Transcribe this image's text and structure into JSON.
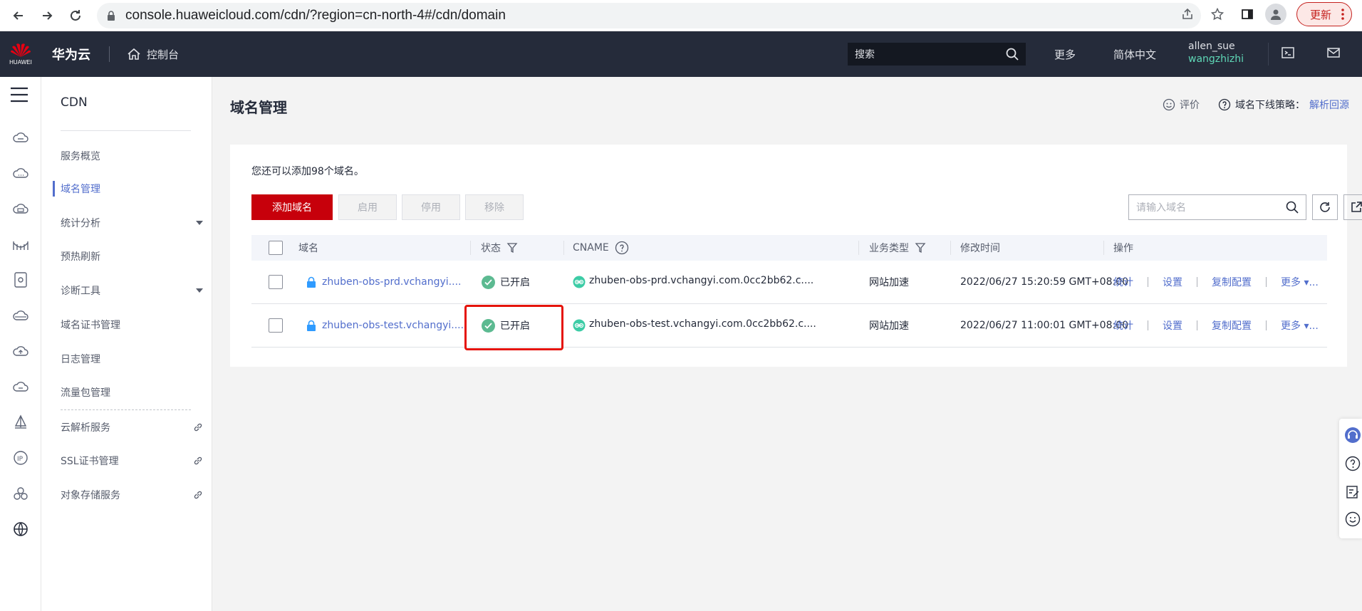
{
  "browser": {
    "url": "console.huaweicloud.com/cdn/?region=cn-north-4#/cdn/domain",
    "update_label": "更新"
  },
  "header": {
    "logo_text": "HUAWEI",
    "brand": "华为云",
    "console_label": "控制台",
    "search_placeholder": "搜索",
    "more_label": "更多",
    "language_label": "简体中文",
    "user_name": "allen_sue",
    "user_sub": "wangzhizhi"
  },
  "sidebar": {
    "title": "CDN",
    "items": [
      {
        "label": "服务概览"
      },
      {
        "label": "域名管理"
      },
      {
        "label": "统计分析"
      },
      {
        "label": "预热刷新"
      },
      {
        "label": "诊断工具"
      },
      {
        "label": "域名证书管理"
      },
      {
        "label": "日志管理"
      },
      {
        "label": "流量包管理"
      },
      {
        "label": "云解析服务"
      },
      {
        "label": "SSL证书管理"
      },
      {
        "label": "对象存储服务"
      }
    ]
  },
  "page": {
    "title": "域名管理",
    "rate_label": "评价",
    "policy_label": "域名下线策略：",
    "policy_link": "解析回源",
    "quota_text": "您还可以添加98个域名。",
    "buttons": {
      "add": "添加域名",
      "enable": "启用",
      "disable": "停用",
      "remove": "移除"
    },
    "search_placeholder": "请输入域名"
  },
  "table": {
    "columns": [
      "域名",
      "状态",
      "CNAME",
      "业务类型",
      "修改时间",
      "操作"
    ],
    "rows": [
      {
        "domain": "zhuben-obs-prd.vchangyi....",
        "status": "已开启",
        "cname": "zhuben-obs-prd.vchangyi.com.0cc2bb62.c....",
        "business_type": "网站加速",
        "modified": "2022/06/27 15:20:59 GMT+08:00",
        "ops": [
          "统计",
          "设置",
          "复制配置",
          "更多"
        ]
      },
      {
        "domain": "zhuben-obs-test.vchangyi....",
        "status": "已开启",
        "cname": "zhuben-obs-test.vchangyi.com.0cc2bb62.c....",
        "business_type": "网站加速",
        "modified": "2022/06/27 11:00:01 GMT+08:00",
        "ops": [
          "统计",
          "设置",
          "复制配置",
          "更多"
        ]
      }
    ]
  },
  "colors": {
    "header_bg": "#252b3a",
    "brand_red": "#c7000b",
    "link_blue": "#526ecc",
    "status_green": "#5cba91",
    "highlight_red": "#e5140a"
  }
}
